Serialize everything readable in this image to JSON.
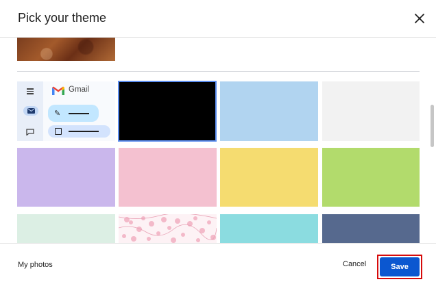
{
  "dialog": {
    "title": "Pick your theme"
  },
  "preview": {
    "app_name": "Gmail"
  },
  "themes": [
    {
      "name": "Black",
      "color": "#000000",
      "selected": true
    },
    {
      "name": "Light blue",
      "color": "#b1d4f0"
    },
    {
      "name": "Light gray",
      "color": "#f2f2f2"
    },
    {
      "name": "Lavender",
      "color": "#cab7ec"
    },
    {
      "name": "Pink",
      "color": "#f4c1d0"
    },
    {
      "name": "Yellow",
      "color": "#f5dc70"
    },
    {
      "name": "Green",
      "color": "#b2db6c"
    },
    {
      "name": "Mint",
      "color": "#dcefe4"
    },
    {
      "name": "Cherry blossom",
      "color": "#fbe3ea"
    },
    {
      "name": "Teal",
      "color": "#8bdce0"
    },
    {
      "name": "Slate blue",
      "color": "#56698e"
    }
  ],
  "footer": {
    "my_photos": "My photos",
    "cancel": "Cancel",
    "save": "Save"
  }
}
